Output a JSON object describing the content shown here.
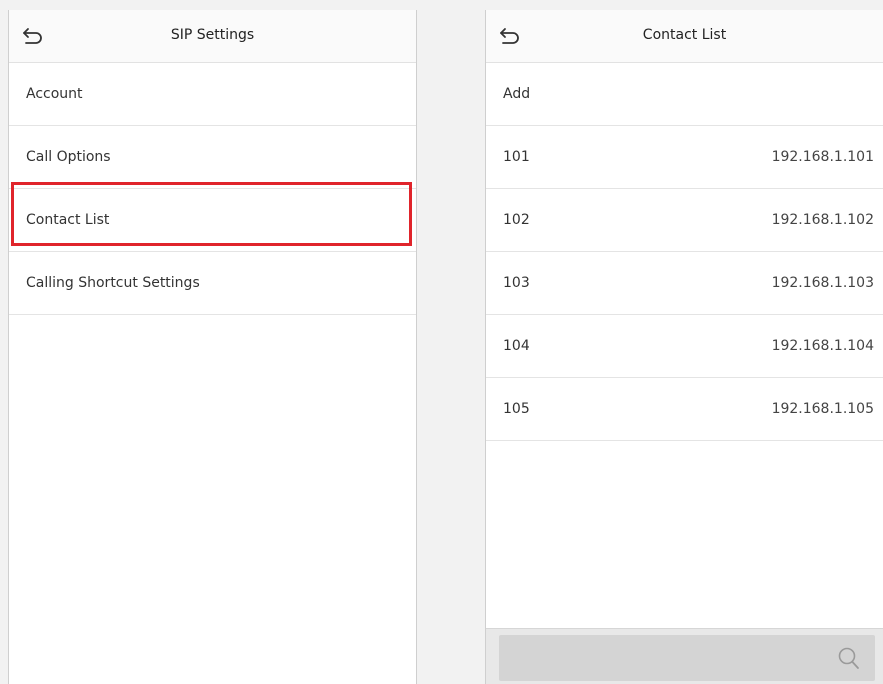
{
  "left": {
    "title": "SIP Settings",
    "items": [
      {
        "label": "Account"
      },
      {
        "label": "Call Options"
      },
      {
        "label": "Contact List",
        "highlighted": true
      },
      {
        "label": "Calling Shortcut Settings"
      }
    ]
  },
  "right": {
    "title": "Contact List",
    "add_label": "Add",
    "contacts": [
      {
        "number": "101",
        "ip": "192.168.1.101"
      },
      {
        "number": "102",
        "ip": "192.168.1.102"
      },
      {
        "number": "103",
        "ip": "192.168.1.103"
      },
      {
        "number": "104",
        "ip": "192.168.1.104"
      },
      {
        "number": "105",
        "ip": "192.168.1.105"
      }
    ]
  },
  "icons": {
    "back": "back-arrow-icon",
    "search": "search-icon"
  },
  "colors": {
    "highlight": "#e0242b",
    "background": "#ffffff",
    "search_bar": "#d4d4d4"
  }
}
